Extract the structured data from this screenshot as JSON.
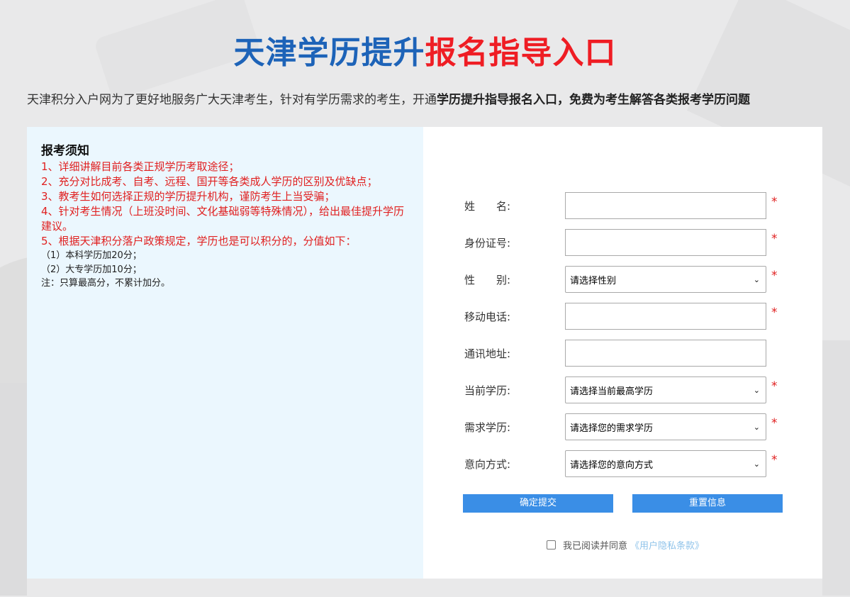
{
  "header": {
    "title_blue": "天津学历提升",
    "title_red": "报名指导入口",
    "intro_plain": "天津积分入户网为了更好地服务广大天津考生，针对有学历需求的考生，开通",
    "intro_bold": "学历提升指导报名入口，免费为考生解答各类报考学历问题"
  },
  "notice": {
    "title": "报考须知",
    "items": [
      "1、详细讲解目前各类正规学历考取途径；",
      "2、充分对比成考、自考、远程、国开等各类成人学历的区别及优缺点；",
      "3、教考生如何选择正规的学历提升机构，谨防考生上当受骗；",
      "4、针对考生情况（上班没时间、文化基础弱等特殊情况），给出最佳提升学历建议。",
      "5、根据天津积分落户政策规定，学历也是可以积分的，分值如下："
    ],
    "sub_items": [
      "（1）本科学历加20分；",
      "（2）大专学历加10分；",
      "注：只算最高分，不累计加分。"
    ]
  },
  "form": {
    "required_mark": "*",
    "name_label": "姓　　名:",
    "id_label": "身份证号:",
    "gender_label": "性　　别:",
    "gender_placeholder": "请选择性别",
    "phone_label": "移动电话:",
    "address_label": "通讯地址:",
    "current_edu_label": "当前学历:",
    "current_edu_placeholder": "请选择当前最高学历",
    "target_edu_label": "需求学历:",
    "target_edu_placeholder": "请选择您的需求学历",
    "method_label": "意向方式:",
    "method_placeholder": "请选择您的意向方式",
    "submit_label": "确定提交",
    "reset_label": "重置信息",
    "agree_text": "我已阅读并同意",
    "privacy_link": "《用户隐私条款》"
  },
  "colors": {
    "title_blue": "#1d63b8",
    "title_red": "#ef1d24",
    "button_blue": "#3a8ee6",
    "notice_bg": "#ebf7fe",
    "required_red": "#e02020"
  }
}
